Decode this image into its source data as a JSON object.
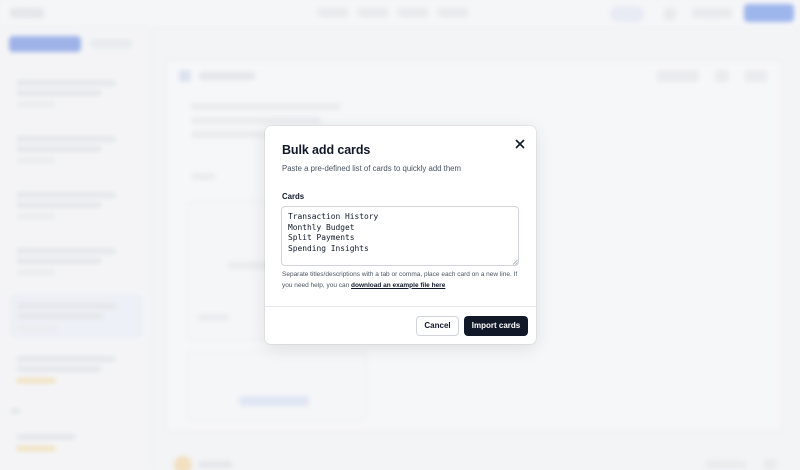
{
  "modal": {
    "title": "Bulk add cards",
    "subtitle": "Paste a pre-defined list of cards to quickly add them",
    "field_label": "Cards",
    "cards": [
      "Transaction History",
      "Monthly Budget",
      "Split Payments",
      "Spending Insights"
    ],
    "help_text": "Separate titles/descriptions with a tab or comma, place each card on a new line. If you need help, you can ",
    "help_link": "download an example file here",
    "cancel_label": "Cancel",
    "import_label": "Import cards",
    "close_icon": "close-icon"
  },
  "colors": {
    "primary_button": "#111827",
    "background": "#f3f4f6",
    "accent_blue": "#3b6fe0"
  }
}
